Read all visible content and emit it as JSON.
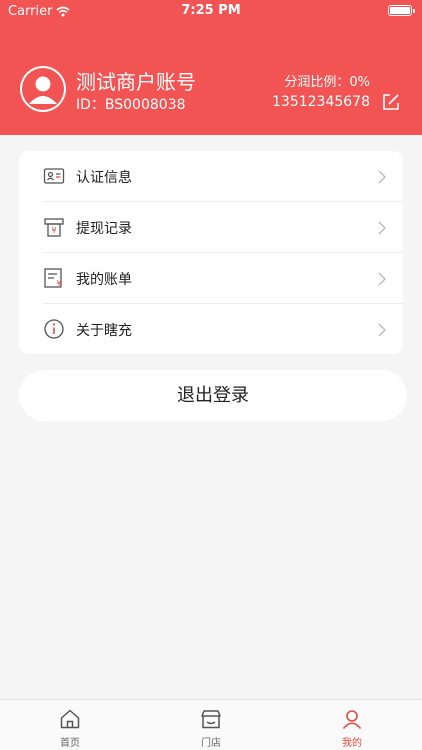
{
  "status_bar": {
    "carrier": "Carrier",
    "time": "7:25 PM"
  },
  "profile": {
    "name": "测试商户账号",
    "id_text": "ID：BS0008038",
    "share_ratio": "分润比例：0%",
    "phone": "13512345678"
  },
  "menu": [
    {
      "label": "认证信息",
      "icon": "id-card-icon"
    },
    {
      "label": "提现记录",
      "icon": "withdraw-icon"
    },
    {
      "label": "我的账单",
      "icon": "bill-icon"
    },
    {
      "label": "关于瞎充",
      "icon": "info-icon"
    }
  ],
  "logout_label": "退出登录",
  "tabbar": [
    {
      "label": "首页",
      "icon": "home-icon",
      "active": false
    },
    {
      "label": "门店",
      "icon": "store-icon",
      "active": false
    },
    {
      "label": "我的",
      "icon": "user-icon",
      "active": true
    }
  ],
  "colors": {
    "accent": "#f25454",
    "active_tab": "#e84c3d"
  }
}
